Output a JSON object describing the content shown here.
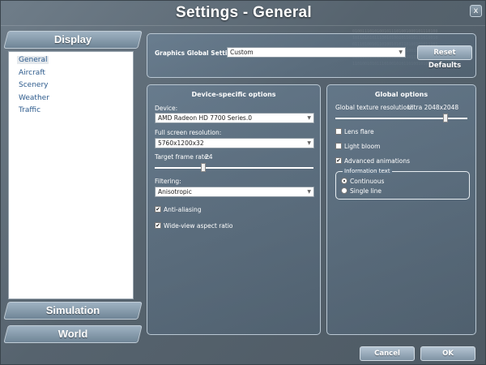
{
  "window": {
    "title": "Settings - General",
    "close_label": "x"
  },
  "sidebar": {
    "categories": {
      "display": "Display",
      "simulation": "Simulation",
      "world": "World"
    },
    "items": [
      {
        "label": "General",
        "selected": true
      },
      {
        "label": "Aircraft"
      },
      {
        "label": "Scenery"
      },
      {
        "label": "Weather"
      },
      {
        "label": "Traffic"
      }
    ]
  },
  "global_settings": {
    "label": "Graphics Global Settings:",
    "value": "Custom",
    "reset_label": "Reset Defaults"
  },
  "device": {
    "title": "Device-specific options",
    "device_label": "Device:",
    "device_value": "AMD Radeon HD 7700 Series.0",
    "resolution_label": "Full screen resolution:",
    "resolution_value": "5760x1200x32",
    "framerate_label": "Target frame rate:",
    "framerate_value": "24",
    "framerate_slider_fraction": 0.3,
    "filtering_label": "Filtering:",
    "filtering_value": "Anisotropic",
    "antialiasing_label": "Anti-aliasing",
    "antialiasing_checked": true,
    "widescreen_label": "Wide-view aspect ratio",
    "widescreen_checked": true
  },
  "global_options": {
    "title": "Global options",
    "texture_label": "Global texture resolution:",
    "texture_value": "Ultra 2048x2048",
    "texture_slider_fraction": 0.85,
    "lens_flare_label": "Lens flare",
    "lens_flare_checked": false,
    "light_bloom_label": "Light bloom",
    "light_bloom_checked": false,
    "advanced_animations_label": "Advanced animations",
    "advanced_animations_checked": true,
    "info_text_legend": "Information text",
    "info_continuous_label": "Continuous",
    "info_single_label": "Single line",
    "info_selected": "Continuous"
  },
  "footer": {
    "cancel_label": "Cancel",
    "ok_label": "OK"
  },
  "colors": {
    "link_blue": "#2c5a8c",
    "panel_border": "#b9c7d3"
  }
}
